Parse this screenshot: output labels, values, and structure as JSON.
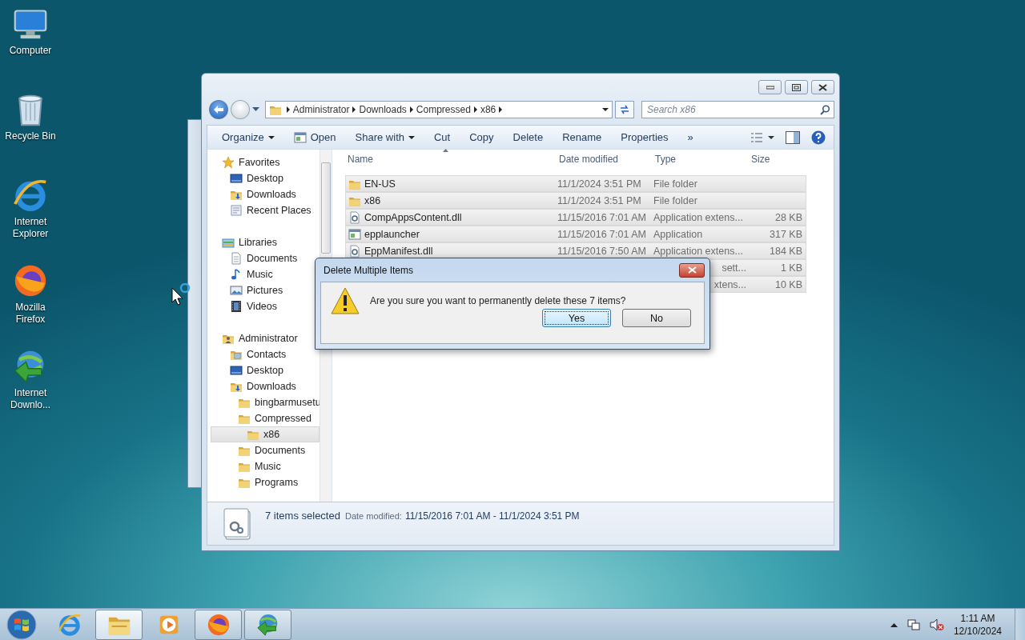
{
  "desktop_icons": [
    {
      "label": "Computer",
      "kind": "computer"
    },
    {
      "label": "Recycle Bin",
      "kind": "recycle"
    },
    {
      "label": "Internet Explorer",
      "kind": "ie"
    },
    {
      "label": "Mozilla Firefox",
      "kind": "firefox"
    },
    {
      "label": "Internet Downlo...",
      "kind": "idm"
    }
  ],
  "explorer": {
    "breadcrumb": [
      "Administrator",
      "Downloads",
      "Compressed",
      "x86"
    ],
    "search": {
      "placeholder": "Search x86"
    },
    "toolbar": [
      {
        "label": "Organize",
        "kind": "menu"
      },
      {
        "label": "Open",
        "kind": "icon"
      },
      {
        "label": "Share with",
        "kind": "menu"
      },
      {
        "label": "Cut",
        "kind": "plain"
      },
      {
        "label": "Copy",
        "kind": "plain"
      },
      {
        "label": "Delete",
        "kind": "plain"
      },
      {
        "label": "Rename",
        "kind": "plain"
      },
      {
        "label": "Properties",
        "kind": "plain"
      },
      {
        "label": "»",
        "kind": "plain"
      }
    ],
    "nav_tree": [
      {
        "label": "Favorites",
        "kind": "star",
        "selected": false,
        "children": [
          {
            "label": "Desktop",
            "kind": "desktop",
            "selected": false
          },
          {
            "label": "Downloads",
            "kind": "downloads",
            "selected": false
          },
          {
            "label": "Recent Places",
            "kind": "recent",
            "selected": false
          }
        ]
      },
      {
        "label": "Libraries",
        "kind": "library",
        "selected": false,
        "children": [
          {
            "label": "Documents",
            "kind": "document",
            "selected": false
          },
          {
            "label": "Music",
            "kind": "music",
            "selected": false
          },
          {
            "label": "Pictures",
            "kind": "pictures",
            "selected": false
          },
          {
            "label": "Videos",
            "kind": "videos",
            "selected": false
          }
        ]
      },
      {
        "label": "Administrator",
        "kind": "user",
        "selected": false,
        "children": [
          {
            "label": "Contacts",
            "kind": "contacts",
            "selected": false
          },
          {
            "label": "Desktop",
            "kind": "desktop",
            "selected": false
          },
          {
            "label": "Downloads",
            "kind": "downloads",
            "selected": false,
            "children": [
              {
                "label": "bingbarmusetu",
                "kind": "folder",
                "selected": false
              },
              {
                "label": "Compressed",
                "kind": "folder",
                "selected": false,
                "children": [
                  {
                    "label": "x86",
                    "kind": "folder",
                    "selected": true
                  }
                ]
              },
              {
                "label": "Documents",
                "kind": "folder",
                "selected": false
              },
              {
                "label": "Music",
                "kind": "folder",
                "selected": false
              },
              {
                "label": "Programs",
                "kind": "folder",
                "selected": false
              }
            ]
          }
        ]
      }
    ],
    "columns": [
      "Name",
      "Date modified",
      "Type",
      "Size"
    ],
    "files": [
      {
        "kind": "folder",
        "name": "EN-US",
        "date": "11/1/2024 3:51 PM",
        "type": "File folder",
        "selected": true
      },
      {
        "kind": "folder",
        "name": "x86",
        "date": "11/1/2024 3:51 PM",
        "type": "File folder",
        "selected": true
      },
      {
        "kind": "dll",
        "name": "CompAppsContent.dll",
        "date": "11/15/2016 7:01 AM",
        "type": "Application extens...",
        "size": "28 KB",
        "selected": true
      },
      {
        "kind": "exe",
        "name": "epplauncher",
        "date": "11/15/2016 7:01 AM",
        "type": "Application",
        "size": "317 KB",
        "selected": true
      },
      {
        "kind": "dll",
        "name": "EppManifest.dll",
        "date": "11/15/2016 7:50 AM",
        "type": "Application extens...",
        "size": "184 KB",
        "selected": true
      },
      {
        "kind": "partial",
        "type": "sett...",
        "size": "1 KB",
        "selected": true
      },
      {
        "kind": "partial",
        "type": "xtens...",
        "size": "10 KB",
        "selected": true
      }
    ],
    "status": {
      "count": "7 items selected",
      "date_label": "Date modified:",
      "date_range": "11/15/2016 7:01 AM - 11/1/2024 3:51 PM"
    }
  },
  "dialog": {
    "title": "Delete Multiple Items",
    "message": "Are you sure you want to permanently delete these 7 items?",
    "buttons": [
      {
        "label": "Yes",
        "default": true
      },
      {
        "label": "No",
        "default": false
      }
    ]
  },
  "taskbar": {
    "apps": [
      {
        "kind": "ie",
        "running": false,
        "selected": false
      },
      {
        "kind": "explorer",
        "running": true,
        "selected": true
      },
      {
        "kind": "media",
        "running": false,
        "selected": false
      },
      {
        "kind": "firefox",
        "running": true,
        "selected": false
      },
      {
        "kind": "idm",
        "running": true,
        "selected": false
      }
    ],
    "time": "1:11 AM",
    "date": "12/10/2024"
  }
}
